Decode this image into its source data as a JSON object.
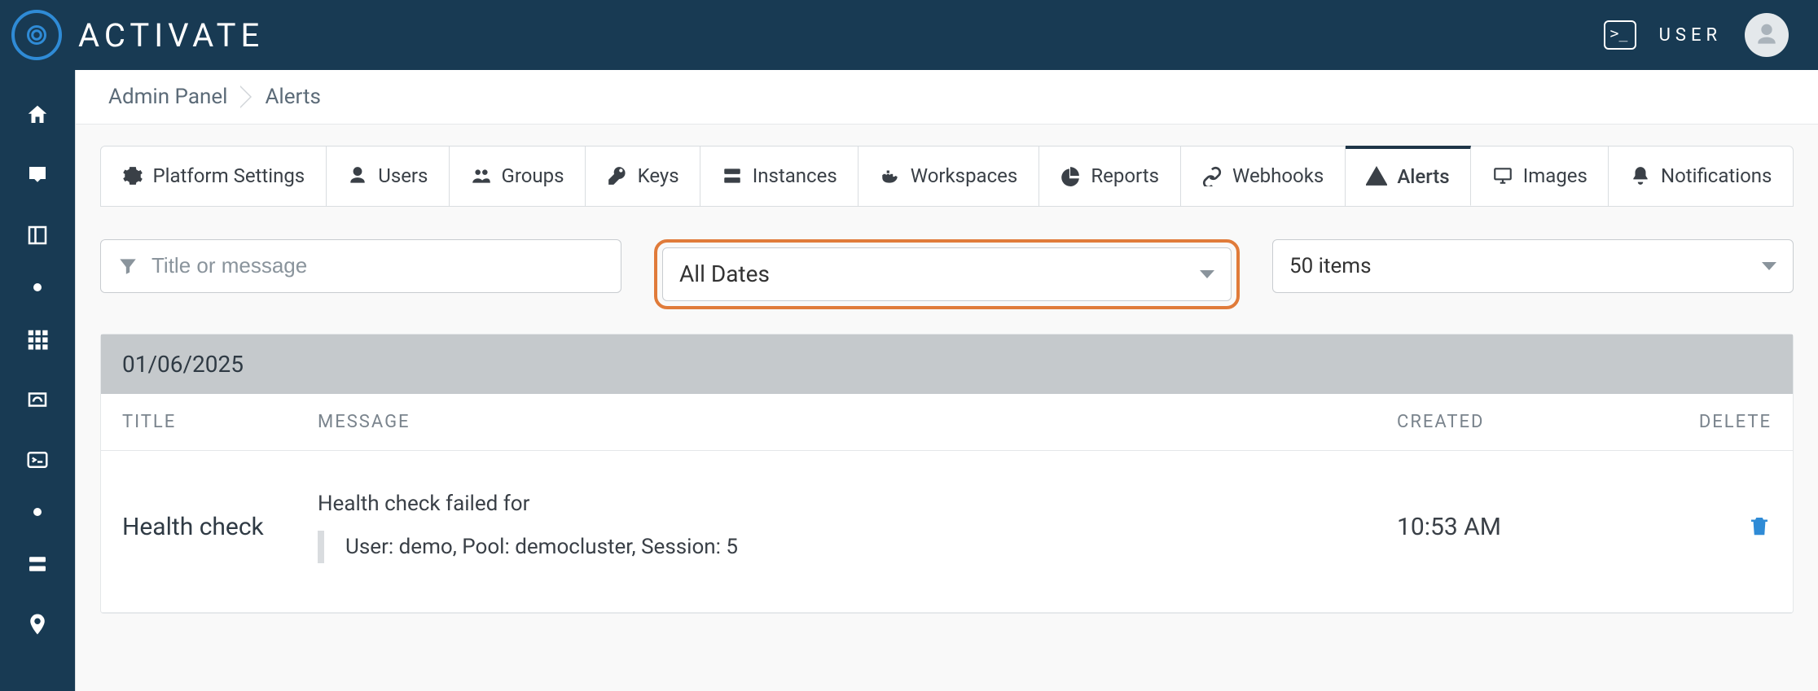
{
  "brand": "ACTIVATE",
  "topbar": {
    "user_label": "USER"
  },
  "breadcrumb": {
    "items": [
      "Admin Panel",
      "Alerts"
    ]
  },
  "tabs": [
    {
      "label": "Platform Settings",
      "icon": "settings"
    },
    {
      "label": "Users",
      "icon": "user"
    },
    {
      "label": "Groups",
      "icon": "group"
    },
    {
      "label": "Keys",
      "icon": "key"
    },
    {
      "label": "Instances",
      "icon": "server"
    },
    {
      "label": "Workspaces",
      "icon": "docker"
    },
    {
      "label": "Reports",
      "icon": "pie"
    },
    {
      "label": "Webhooks",
      "icon": "link"
    },
    {
      "label": "Alerts",
      "icon": "alert",
      "active": true
    },
    {
      "label": "Images",
      "icon": "monitor"
    },
    {
      "label": "Notifications",
      "icon": "bell"
    }
  ],
  "filters": {
    "search_placeholder": "Title or message",
    "date_value": "All Dates",
    "page_size": "50 items"
  },
  "table": {
    "date_group": "01/06/2025",
    "columns": {
      "title": "TITLE",
      "message": "MESSAGE",
      "created": "CREATED",
      "delete": "DELETE"
    },
    "rows": [
      {
        "title": "Health check",
        "message_line1": "Health check failed for",
        "message_line2": "User: demo, Pool: democluster, Session: 5",
        "created": "10:53 AM"
      }
    ]
  }
}
